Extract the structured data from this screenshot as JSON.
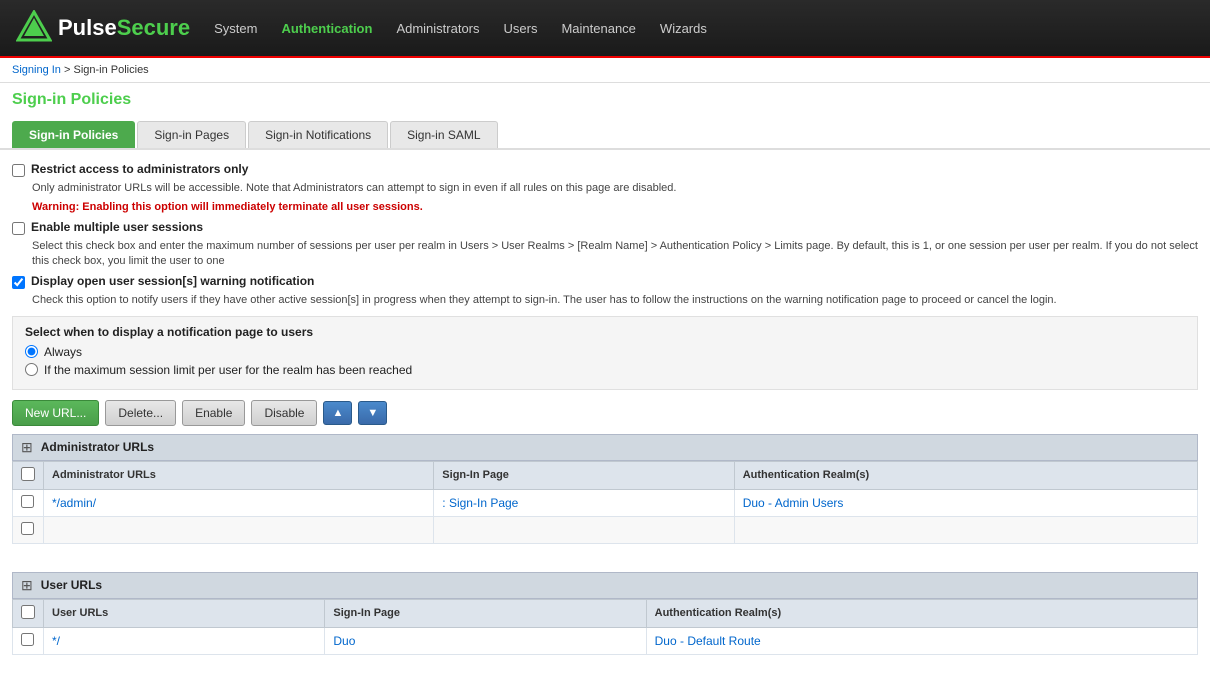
{
  "header": {
    "logo_pulse": "Pulse",
    "logo_secure": "Secure",
    "nav_items": [
      {
        "label": "System",
        "active": false
      },
      {
        "label": "Authentication",
        "active": true
      },
      {
        "label": "Administrators",
        "active": false
      },
      {
        "label": "Users",
        "active": false
      },
      {
        "label": "Maintenance",
        "active": false
      },
      {
        "label": "Wizards",
        "active": false
      }
    ]
  },
  "breadcrumb": {
    "signing_in": "Signing In",
    "separator": " > ",
    "current": "Sign-in Policies"
  },
  "page_title": "Sign-in Policies",
  "tabs": [
    {
      "label": "Sign-in Policies",
      "active": true
    },
    {
      "label": "Sign-in Pages",
      "active": false
    },
    {
      "label": "Sign-in Notifications",
      "active": false
    },
    {
      "label": "Sign-in SAML",
      "active": false
    }
  ],
  "options": {
    "restrict_access": {
      "label": "Restrict access to administrators only",
      "checked": false,
      "hint": "Only administrator URLs will be accessible. Note that Administrators can attempt to sign in even if all rules on this page are disabled.",
      "warning": "Warning: Enabling this option will immediately terminate all user sessions."
    },
    "enable_multiple": {
      "label": "Enable multiple user sessions",
      "checked": false,
      "hint": "Select this check box and enter the maximum number of sessions per user per realm in Users > User Realms > [Realm Name] > Authentication Policy > Limits page. By default, this is 1, or one session per user per realm. If you do not select this check box, you limit the user to one"
    },
    "display_warning": {
      "label": "Display open user session[s] warning notification",
      "checked": true,
      "hint": "Check this option to notify users if they have other active session[s] in progress when they attempt to sign-in. The user has to follow the instructions on the warning notification page to proceed or cancel the login."
    }
  },
  "notification_section": {
    "title": "Select when to display a notification page to users",
    "radio_options": [
      {
        "label": "Always",
        "selected": true
      },
      {
        "label": "If the maximum session limit per user for the realm has been reached",
        "selected": false
      }
    ]
  },
  "action_buttons": {
    "new_url": "New URL...",
    "delete": "Delete...",
    "enable": "Enable",
    "disable": "Disable",
    "up_icon": "▲",
    "down_icon": "▼"
  },
  "admin_table": {
    "section_title": "Administrator URLs",
    "columns": [
      "Administrator URLs",
      "Sign-In Page",
      "Authentication Realm(s)"
    ],
    "rows": [
      {
        "url": "*/admin/",
        "sign_in_page": ": Sign-In Page",
        "auth_realm": "Duo - Admin Users"
      }
    ]
  },
  "user_table": {
    "section_title": "User URLs",
    "columns": [
      "User URLs",
      "Sign-In Page",
      "Authentication Realm(s)"
    ],
    "rows": [
      {
        "url": "*/",
        "sign_in_page": "Duo",
        "auth_realm": "Duo - Default Route"
      }
    ]
  }
}
